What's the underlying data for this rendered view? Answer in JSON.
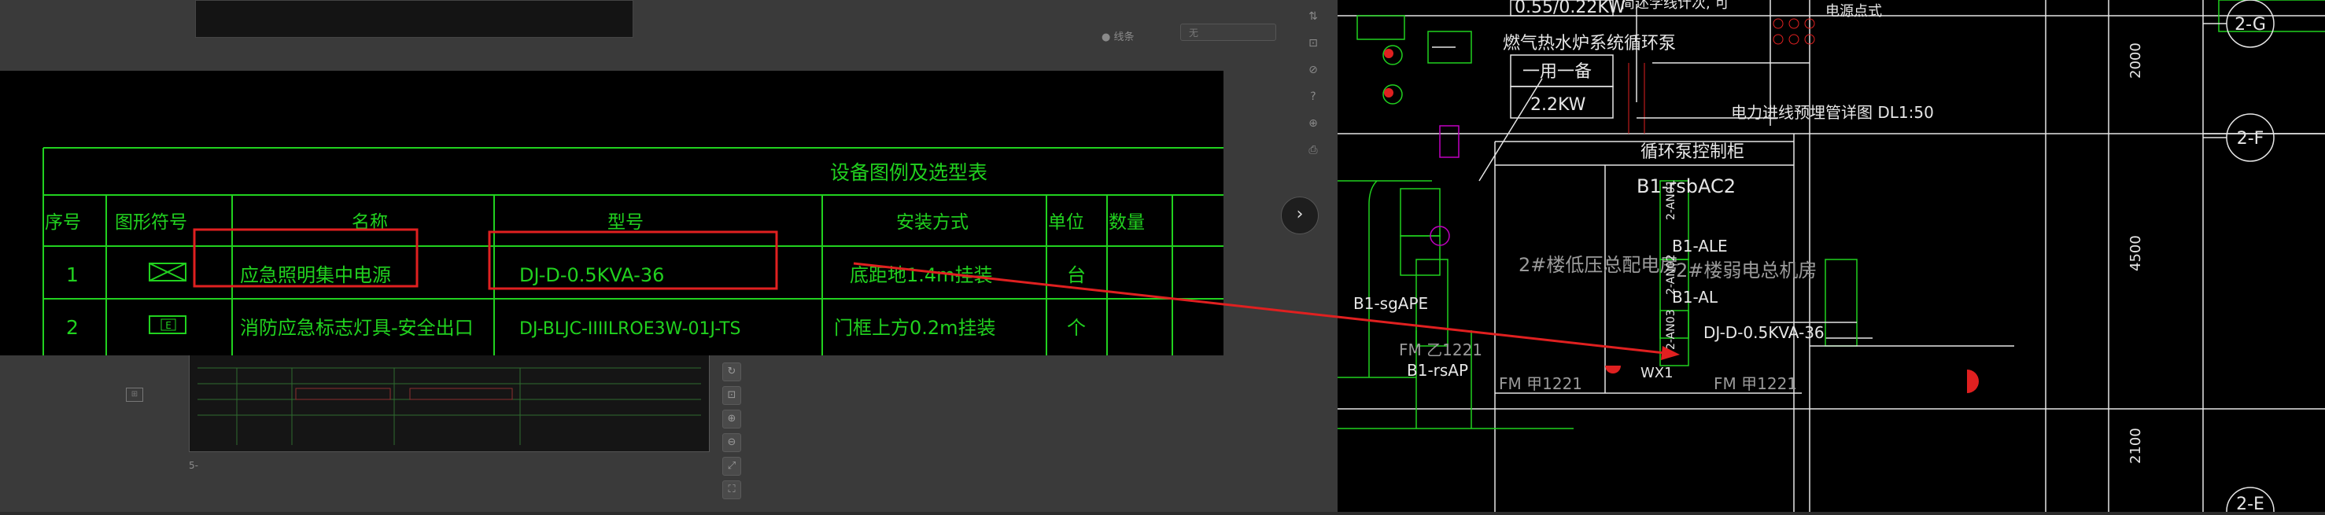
{
  "background_viewer": {
    "option_label": "● 线条",
    "select_value": "无",
    "page_indicator": "5-",
    "thumb_icon": "⊞",
    "side_tools": [
      "↻",
      "⊡",
      "⊕",
      "⊖",
      "⤢",
      "⛶"
    ],
    "right_tools": [
      "⇅",
      "⊡",
      "⊘",
      "?",
      "⊕",
      "⎙"
    ]
  },
  "legend_table": {
    "title": "设备图例及选型表",
    "headers": [
      "序号",
      "图形符号",
      "名称",
      "型号",
      "安装方式",
      "单位",
      "数量"
    ],
    "rows": [
      {
        "no": "1",
        "symbol": "emergency-box",
        "name": "应急照明集中电源",
        "model": "DJ-D-0.5KVA-36",
        "install": "底距地1.4m挂装",
        "unit": "台",
        "qty": ""
      },
      {
        "no": "2",
        "symbol": "exit-sign",
        "name": "消防应急标志灯具-安全出口",
        "model": "DJ-BLJC-IIIILROE3W-01J-TS",
        "install": "门框上方0.2m挂装",
        "unit": "个",
        "qty": ""
      }
    ],
    "symbol_exit_text": "E"
  },
  "next_button_label": "›",
  "cad_drawing": {
    "top_power": "0.55/0.22KW",
    "top_note1": "简述学线计次, 可",
    "top_note2": "电源点式",
    "boiler_label": "燃气热水炉系统循环泵",
    "duty_label": "一用一备",
    "power_label": "2.2KW",
    "detail_title": "电力进线预埋管详图 DL1:50",
    "pump_cabinet": "循环泵控制柜",
    "rsbac2": "B1-rsbAC2",
    "ale": "B1-ALE",
    "al": "B1-AL",
    "djd": "DJ-D-0.5KVA-36",
    "room1": "2#楼低压总配电房",
    "room2": "2#楼弱电总机房",
    "sgape": "B1-sgAPE",
    "rsap": "B1-rsAP",
    "fm1": "FM 乙1221",
    "fm2": "FM 甲1221",
    "fm3": "FM 甲1221",
    "wx1": "WX1",
    "v1": "2-AN01",
    "v2": "2-AN02",
    "v3": "2-AN03",
    "axis1": "2-G",
    "axis2": "2-F",
    "axis3": "2-E",
    "dim1": "2000",
    "dim2": "4500",
    "dim3": "2100"
  },
  "colors": {
    "cad_green": "#21d11f",
    "cad_white": "#e6e6e6",
    "highlight_red": "#e02020",
    "panel_black": "#000000"
  }
}
